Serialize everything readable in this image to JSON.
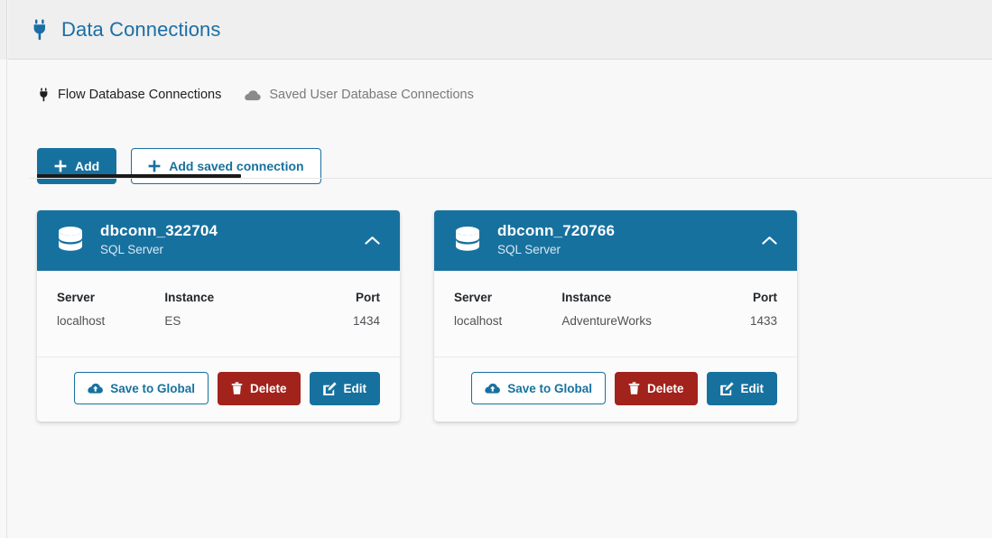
{
  "header": {
    "title": "Data Connections",
    "icon": "plug-icon"
  },
  "tabs": [
    {
      "label": "Flow Database Connections",
      "icon": "plug-icon",
      "active": true
    },
    {
      "label": "Saved User Database Connections",
      "icon": "cloud-icon",
      "active": false
    }
  ],
  "toolbar": {
    "add_label": "Add",
    "add_saved_label": "Add saved connection",
    "add_icon": "plus-icon"
  },
  "colors": {
    "brand_blue": "#17719f",
    "danger_red": "#a2231c",
    "header_bg": "#efefef",
    "page_bg": "#f8f8f8",
    "active_tab_underline": "#1a1a1a"
  },
  "detail_headers": {
    "server": "Server",
    "instance": "Instance",
    "port": "Port"
  },
  "card_actions": {
    "save_label": "Save to Global",
    "delete_label": "Delete",
    "edit_label": "Edit",
    "save_icon": "cloud-upload-icon",
    "delete_icon": "trash-icon",
    "edit_icon": "pencil-square-icon",
    "collapse_icon": "chevron-up-icon"
  },
  "connections": [
    {
      "name": "dbconn_322704",
      "type": "SQL Server",
      "server": "localhost",
      "instance": "ES",
      "port": "1434"
    },
    {
      "name": "dbconn_720766",
      "type": "SQL Server",
      "server": "localhost",
      "instance": "AdventureWorks",
      "port": "1433"
    }
  ]
}
